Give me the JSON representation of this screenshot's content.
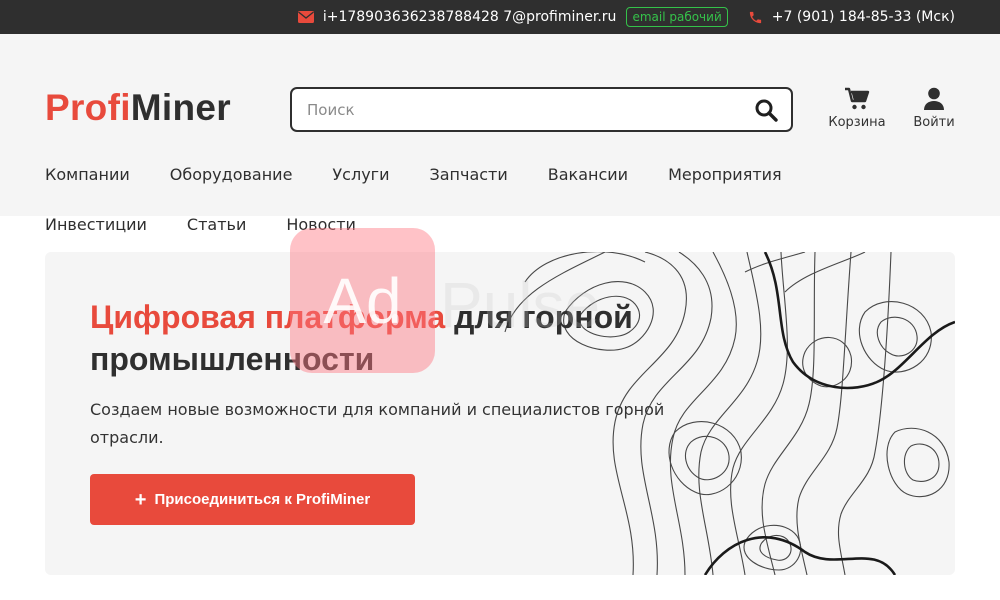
{
  "topbar": {
    "email": "i+178903636238788428 7@profiminer.ru",
    "email_badge": "email рабочий",
    "phone": "+7 (901) 184-85-33 (Мск)"
  },
  "logo": {
    "part1": "Profi",
    "part2": "Miner"
  },
  "search": {
    "placeholder": "Поиск"
  },
  "header_actions": {
    "cart": "Корзина",
    "login": "Войти"
  },
  "nav": {
    "row1": [
      "Компании",
      "Оборудование",
      "Услуги",
      "Запчасти",
      "Вакансии",
      "Мероприятия"
    ],
    "row2": [
      "Инвестиции",
      "Статьи",
      "Новости"
    ]
  },
  "hero": {
    "title_accent": "Цифровая платформа",
    "title_rest": " для горной промышленности",
    "subtitle": "Создаем новые возможности для компаний и специалистов горной отрасли.",
    "cta_plus": "+",
    "cta": "Присоединиться к ProfiMiner"
  },
  "watermark": {
    "text": "Ad",
    "text2": "Pulse"
  },
  "colors": {
    "accent": "#e84a3c",
    "dark": "#2f2f2f",
    "badge": "#35c24a",
    "header_bg": "#f5f5f5"
  },
  "icons": [
    "envelope-icon",
    "phone-icon",
    "search-icon",
    "cart-icon",
    "user-icon",
    "topo-map-icon"
  ]
}
